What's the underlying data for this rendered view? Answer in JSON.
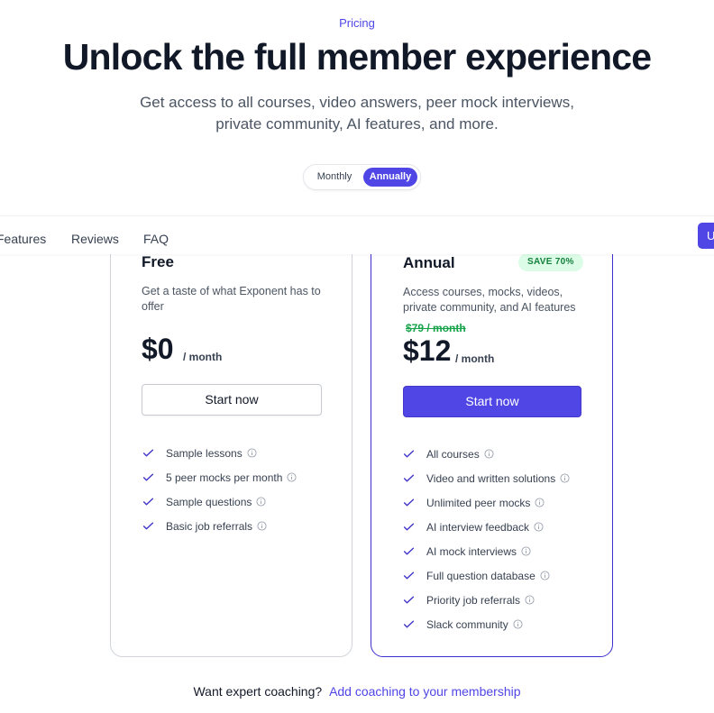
{
  "header": {
    "eyebrow": "Pricing",
    "title": "Unlock the full member experience",
    "subtitle": "Get access to all courses, video answers, peer mock interviews, private community, AI features, and more."
  },
  "billing_toggle": {
    "options": [
      "Monthly",
      "Annually"
    ],
    "selected": "Annually"
  },
  "subnav": {
    "items": [
      "Features",
      "Reviews",
      "FAQ"
    ],
    "cta_label": "U"
  },
  "plans": [
    {
      "name": "Free",
      "description": "Get a taste of what Exponent has to offer",
      "price": "$0",
      "period": "/ month",
      "cta": "Start now",
      "features": [
        "Sample lessons",
        "5 peer mocks per month",
        "Sample questions",
        "Basic job referrals"
      ]
    },
    {
      "name": "Annual",
      "badge": "SAVE 70%",
      "description": "Access courses, mocks, videos, private community, and AI features",
      "old_price": "$79 / month",
      "price": "$12",
      "period": "/ month",
      "cta": "Start now",
      "features": [
        "All courses",
        "Video and written solutions",
        "Unlimited peer mocks",
        "AI interview feedback",
        "AI mock interviews",
        "Full question database",
        "Priority job referrals",
        "Slack community"
      ]
    }
  ],
  "coaching": {
    "prompt": "Want expert coaching?",
    "link": "Add coaching to your membership"
  },
  "colors": {
    "accent": "#4f46e5",
    "badge_bg": "#dcfce7",
    "badge_text": "#15803d"
  }
}
